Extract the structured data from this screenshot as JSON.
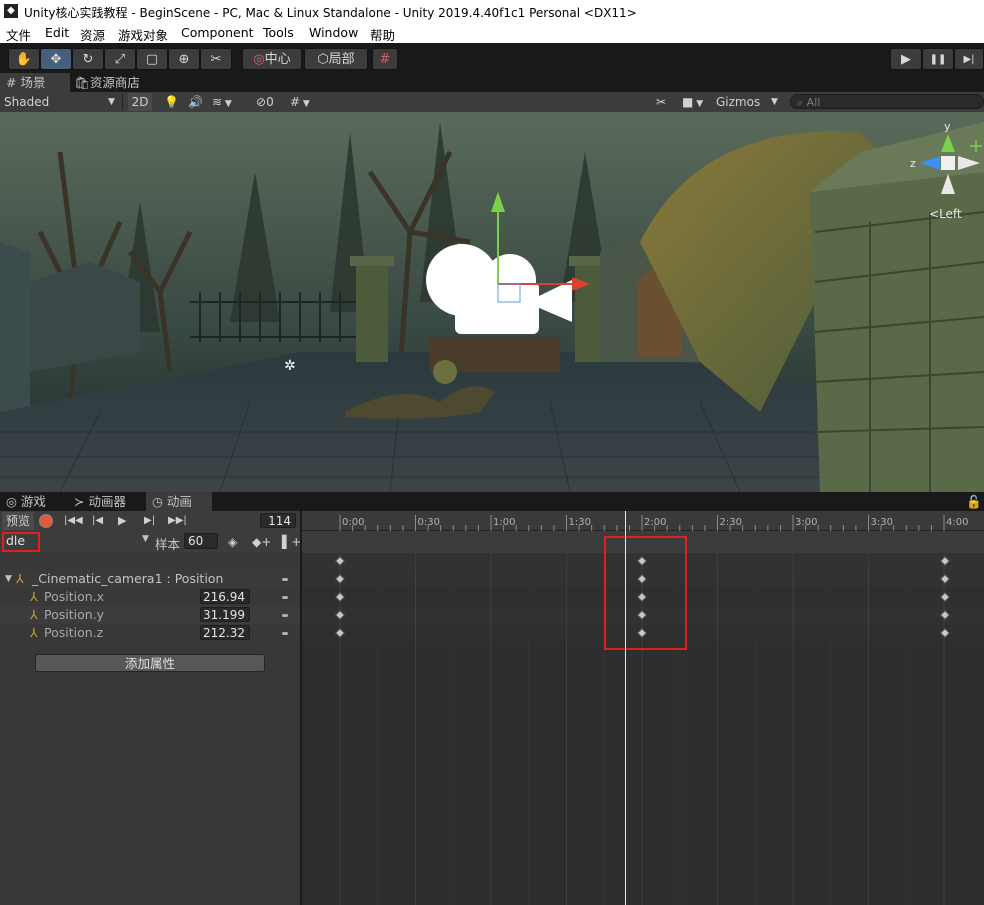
{
  "window": {
    "title": "Unity核心实践教程 - BeginScene - PC, Mac & Linux Standalone - Unity 2019.4.40f1c1 Personal <DX11>",
    "logo_letter": "◆"
  },
  "menubar": {
    "items": [
      "文件",
      "Edit",
      "资源",
      "游戏对象",
      "Component",
      "Tools",
      "Window",
      "帮助"
    ]
  },
  "toolbar": {
    "tools": [
      {
        "name": "hand-tool",
        "glyph": "✋"
      },
      {
        "name": "move-tool",
        "glyph": "✥"
      },
      {
        "name": "rotate-tool",
        "glyph": "↻"
      },
      {
        "name": "scale-tool",
        "glyph": "⤢"
      },
      {
        "name": "rect-tool",
        "glyph": "▢"
      },
      {
        "name": "transform-tool",
        "glyph": "⊕"
      },
      {
        "name": "custom-tool",
        "glyph": "✂"
      }
    ],
    "pivot_label": "中心",
    "local_label": "局部",
    "grid_glyph": "#",
    "play_glyph": "▶",
    "pause_glyph": "❚❚",
    "step_glyph": "▶|"
  },
  "scene_tabs": {
    "scene": "场景",
    "asset_store": "资源商店"
  },
  "scene_bar": {
    "shading": "Shaded",
    "mode_2d": "2D",
    "hidden_count": "0",
    "gizmos": "Gizmos",
    "search_placeholder": "All"
  },
  "scene_view": {
    "axis_y": "y",
    "axis_z": "z",
    "view_label": "Left"
  },
  "anim_tabs": {
    "game": "游戏",
    "animator": "动画器",
    "animation": "动画"
  },
  "anim_controls": {
    "preview": "预览",
    "frame": "114",
    "clip": "dle",
    "samples_label": "样本",
    "samples": "60"
  },
  "timeline": {
    "ticks": [
      "0:00",
      "0:30",
      "1:00",
      "1:30",
      "2:00",
      "2:30",
      "3:00",
      "3:30",
      "4:00"
    ]
  },
  "properties": {
    "group": "_Cinematic_camera1 : Position",
    "rows": [
      {
        "name": "Position.x",
        "value": "216.94"
      },
      {
        "name": "Position.y",
        "value": "31.199"
      },
      {
        "name": "Position.z",
        "value": "212.32"
      }
    ],
    "add_button": "添加属性"
  },
  "colors": {
    "highlight_red": "#e02020",
    "accent_blue": "#3d8ff5",
    "record_red": "#e05a3a"
  }
}
